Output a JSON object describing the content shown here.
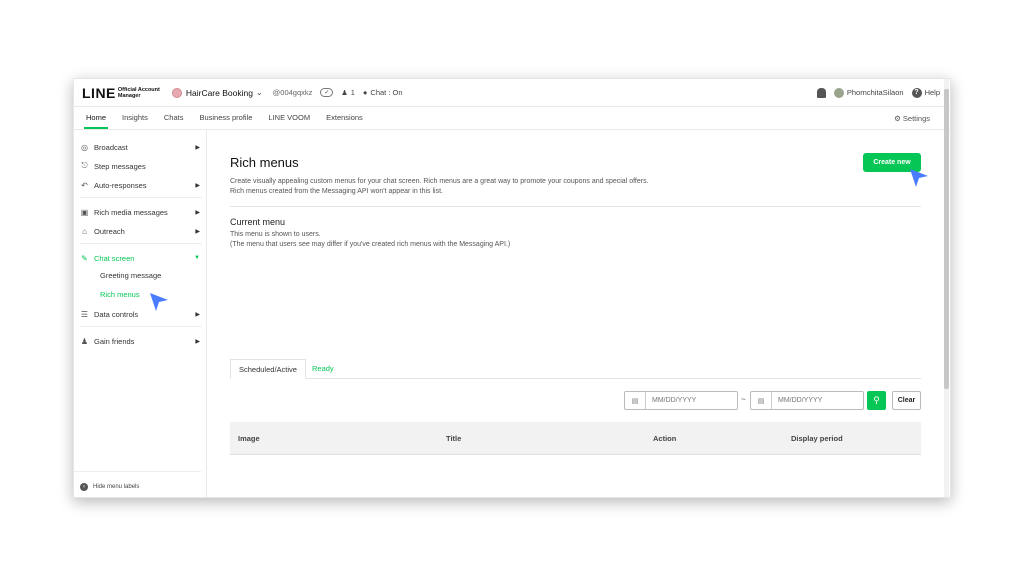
{
  "logo": {
    "main": "LINE",
    "sub1": "Official Account",
    "sub2": "Manager"
  },
  "account": {
    "name": "HairCare Booking",
    "id": "@004gqxkz",
    "badge": "✓",
    "friends": "1",
    "chat_status": "Chat : On"
  },
  "user": {
    "name": "PhornchitaSilaon",
    "help": "Help"
  },
  "tabs": [
    "Home",
    "Insights",
    "Chats",
    "Business profile",
    "LINE VOOM",
    "Extensions"
  ],
  "settings_label": "Settings",
  "sidebar": {
    "broadcast": "Broadcast",
    "step_messages": "Step messages",
    "auto_responses": "Auto-responses",
    "rich_media": "Rich media messages",
    "outreach": "Outreach",
    "chat_screen": "Chat screen",
    "greeting_message": "Greeting message",
    "rich_menus": "Rich menus",
    "data_controls": "Data controls",
    "gain_friends": "Gain friends",
    "hide_labels": "Hide menu labels"
  },
  "main": {
    "title": "Rich menus",
    "create_new": "Create new",
    "desc1": "Create visually appealing custom menus for your chat screen. Rich menus are a great way to promote your coupons and special offers.",
    "desc2": "Rich menus created from the Messaging API won't appear in this list.",
    "current_title": "Current menu",
    "current_desc1": "This menu is shown to users.",
    "current_desc2": "(The menu that users see may differ if you've created rich menus with the Messaging API.)",
    "tab_scheduled": "Scheduled/Active",
    "tab_ready": "Ready",
    "date_placeholder": "MM/DD/YYYY",
    "tilde": "~",
    "clear": "Clear",
    "columns": [
      "Image",
      "Title",
      "Action",
      "Display period"
    ]
  },
  "colors": {
    "accent": "#06c755",
    "cursor": "#4a7cff"
  },
  "icons": [
    "bell-icon",
    "help-icon",
    "gear-icon",
    "calendar-icon",
    "search-icon"
  ]
}
